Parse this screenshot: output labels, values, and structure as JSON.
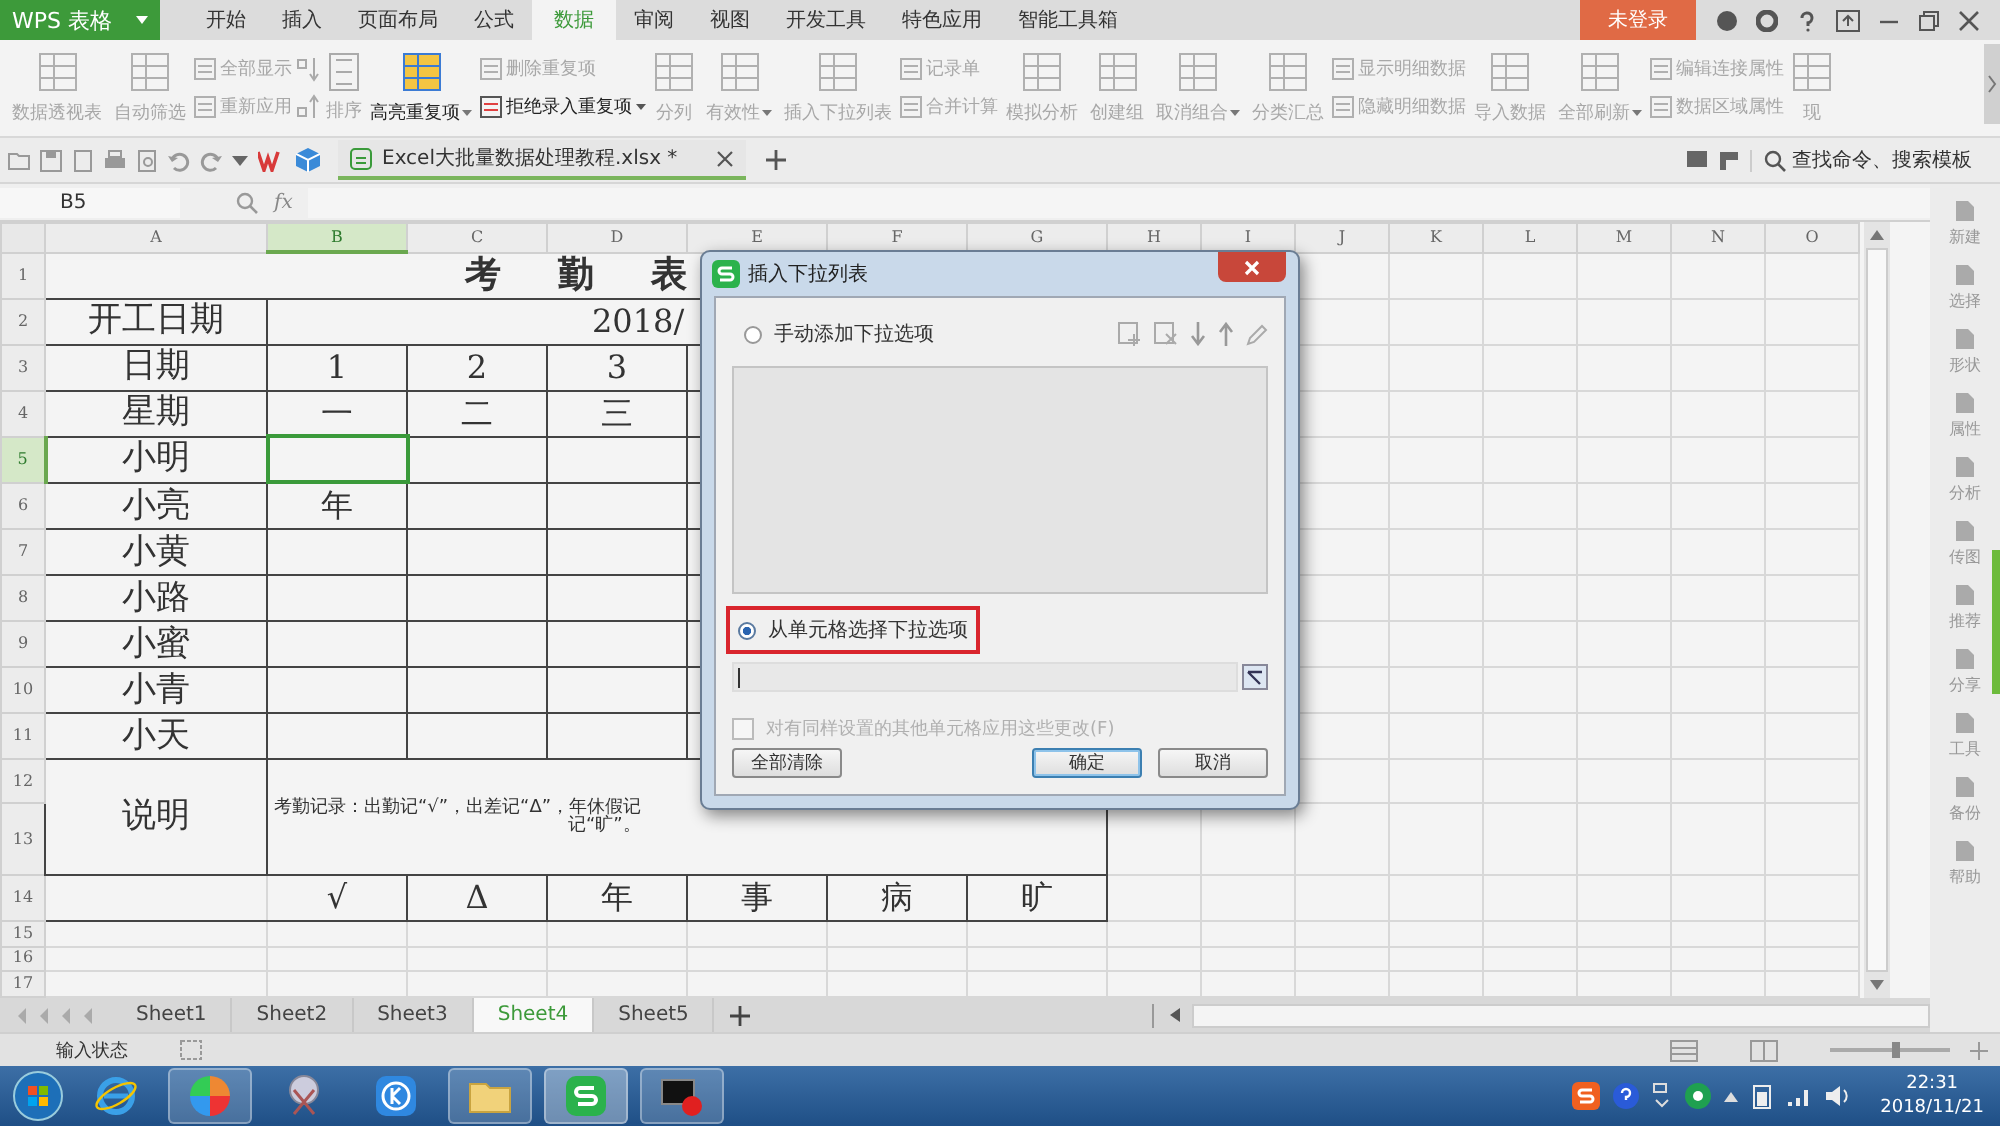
{
  "app_menu": {
    "label": "WPS 表格"
  },
  "menu_tabs": [
    {
      "label": "开始",
      "selected": false
    },
    {
      "label": "插入",
      "selected": false
    },
    {
      "label": "页面布局",
      "selected": false
    },
    {
      "label": "公式",
      "selected": false
    },
    {
      "label": "数据",
      "selected": true
    },
    {
      "label": "审阅",
      "selected": false
    },
    {
      "label": "视图",
      "selected": false
    },
    {
      "label": "开发工具",
      "selected": false
    },
    {
      "label": "特色应用",
      "selected": false
    },
    {
      "label": "智能工具箱",
      "selected": false
    }
  ],
  "login": "未登录",
  "ribbon": [
    {
      "kind": "large",
      "label": "数据透视表",
      "disabled": true
    },
    {
      "kind": "large",
      "label": "自动筛选",
      "disabled": true
    },
    {
      "kind": "stack",
      "items": [
        {
          "label": "全部显示",
          "disabled": true
        },
        {
          "label": "重新应用",
          "disabled": true
        }
      ]
    },
    {
      "kind": "sort",
      "label": "排序",
      "disabled": true
    },
    {
      "kind": "large",
      "label": "高亮重复项",
      "disabled": false,
      "dropdown": true
    },
    {
      "kind": "stack",
      "items": [
        {
          "label": "删除重复项",
          "disabled": true
        },
        {
          "label": "拒绝录入重复项",
          "disabled": false,
          "dropdown": true
        }
      ]
    },
    {
      "kind": "large",
      "label": "分列",
      "disabled": true
    },
    {
      "kind": "large",
      "label": "有效性",
      "disabled": true,
      "dropdown": true
    },
    {
      "kind": "large",
      "label": "插入下拉列表",
      "disabled": true
    },
    {
      "kind": "stack",
      "items": [
        {
          "label": "记录单",
          "disabled": true
        },
        {
          "label": "合并计算",
          "disabled": true
        }
      ]
    },
    {
      "kind": "large",
      "label": "模拟分析",
      "disabled": true
    },
    {
      "kind": "large",
      "label": "创建组",
      "disabled": true
    },
    {
      "kind": "large",
      "label": "取消组合",
      "disabled": true,
      "dropdown": true
    },
    {
      "kind": "large",
      "label": "分类汇总",
      "disabled": true
    },
    {
      "kind": "stack",
      "items": [
        {
          "label": "显示明细数据",
          "disabled": true
        },
        {
          "label": "隐藏明细数据",
          "disabled": true
        }
      ]
    },
    {
      "kind": "large",
      "label": "导入数据",
      "disabled": true
    },
    {
      "kind": "large",
      "label": "全部刷新",
      "disabled": true,
      "dropdown": true
    },
    {
      "kind": "stack",
      "items": [
        {
          "label": "编辑连接属性",
          "disabled": true
        },
        {
          "label": "数据区域属性",
          "disabled": true
        }
      ]
    },
    {
      "kind": "large",
      "label": "现",
      "disabled": true
    }
  ],
  "document_tab": {
    "label": "Excel大批量数据处理教程.xlsx *"
  },
  "command_search": {
    "placeholder": "查找命令、搜索模板"
  },
  "formula_bar": {
    "name_box": "B5",
    "fx": "fx"
  },
  "sheet": {
    "columns": [
      {
        "label": "A",
        "selected": false
      },
      {
        "label": "B",
        "selected": true
      },
      {
        "label": "C",
        "selected": false
      },
      {
        "label": "D",
        "selected": false
      },
      {
        "label": "E",
        "selected": false
      },
      {
        "label": "F",
        "selected": false
      },
      {
        "label": "G",
        "selected": false
      },
      {
        "label": "H",
        "selected": false
      },
      {
        "label": "I",
        "selected": false
      },
      {
        "label": "J",
        "selected": false
      },
      {
        "label": "K",
        "selected": false
      },
      {
        "label": "L",
        "selected": false
      },
      {
        "label": "M",
        "selected": false
      },
      {
        "label": "N",
        "selected": false
      },
      {
        "label": "O",
        "selected": false
      }
    ],
    "rows": [
      {
        "label": "1",
        "selected": false
      },
      {
        "label": "2",
        "selected": false
      },
      {
        "label": "3",
        "selected": false
      },
      {
        "label": "4",
        "selected": false
      },
      {
        "label": "5",
        "selected": true
      },
      {
        "label": "6",
        "selected": false
      },
      {
        "label": "7",
        "selected": false
      },
      {
        "label": "8",
        "selected": false
      },
      {
        "label": "9",
        "selected": false
      },
      {
        "label": "10",
        "selected": false
      },
      {
        "label": "11",
        "selected": false
      },
      {
        "label": "12",
        "selected": false
      },
      {
        "label": "13",
        "selected": false
      },
      {
        "label": "14",
        "selected": false
      },
      {
        "label": "15",
        "selected": false
      },
      {
        "label": "16",
        "selected": false
      },
      {
        "label": "17",
        "selected": false
      }
    ],
    "title": "考 勤 表",
    "start_date": {
      "label": "开工日期",
      "value": "2018/"
    },
    "table_rows": [
      {
        "label": "日期",
        "cells": [
          {
            "text": "1",
            "selected": false
          },
          {
            "text": "2",
            "selected": false
          },
          {
            "text": "3",
            "selected": false
          }
        ]
      },
      {
        "label": "星期",
        "cells": [
          {
            "text": "一",
            "selected": false
          },
          {
            "text": "二",
            "selected": false
          },
          {
            "text": "三",
            "selected": false
          }
        ]
      },
      {
        "label": "小明",
        "cells": [
          {
            "selected": true
          }
        ]
      },
      {
        "label": "小亮",
        "cells": [
          {
            "text": "年",
            "selected": false
          }
        ]
      },
      {
        "label": "小黄"
      },
      {
        "label": "小路"
      },
      {
        "label": "小蜜"
      },
      {
        "label": "小青"
      },
      {
        "label": "小天"
      }
    ],
    "note": {
      "label": "说明",
      "lines": [
        "考勤记录：出勤记“√”，出差记“Δ”，年休假记",
        "记“旷”。"
      ]
    },
    "legend": [
      "√",
      "Δ",
      "年",
      "事",
      "病",
      "旷"
    ]
  },
  "sheet_tabs": [
    {
      "label": "Sheet1",
      "selected": false
    },
    {
      "label": "Sheet2",
      "selected": false
    },
    {
      "label": "Sheet3",
      "selected": false
    },
    {
      "label": "Sheet4",
      "selected": true
    },
    {
      "label": "Sheet5",
      "selected": false
    }
  ],
  "status": "输入状态",
  "side_panel": [
    "新建",
    "选择",
    "形状",
    "属性",
    "分析",
    "传图",
    "推荐",
    "分享",
    "工具",
    "备份",
    "帮助"
  ],
  "dialog": {
    "title": "插入下拉列表",
    "options": [
      {
        "label": "手动添加下拉选项",
        "selected": false,
        "highlighted": false
      },
      {
        "label": "从单元格选择下拉选项",
        "selected": true,
        "highlighted": true
      }
    ],
    "apply_all": {
      "label": "对有同样设置的其他单元格应用这些更改(F)",
      "checked": false,
      "disabled": true
    },
    "buttons": [
      {
        "label": "全部清除",
        "default": false
      },
      {
        "label": "确定",
        "default": true
      },
      {
        "label": "取消",
        "default": false
      }
    ]
  },
  "zoom_slider": {
    "level": 0.55
  },
  "clock": {
    "time": "22:31",
    "date": "2018/11/21"
  }
}
